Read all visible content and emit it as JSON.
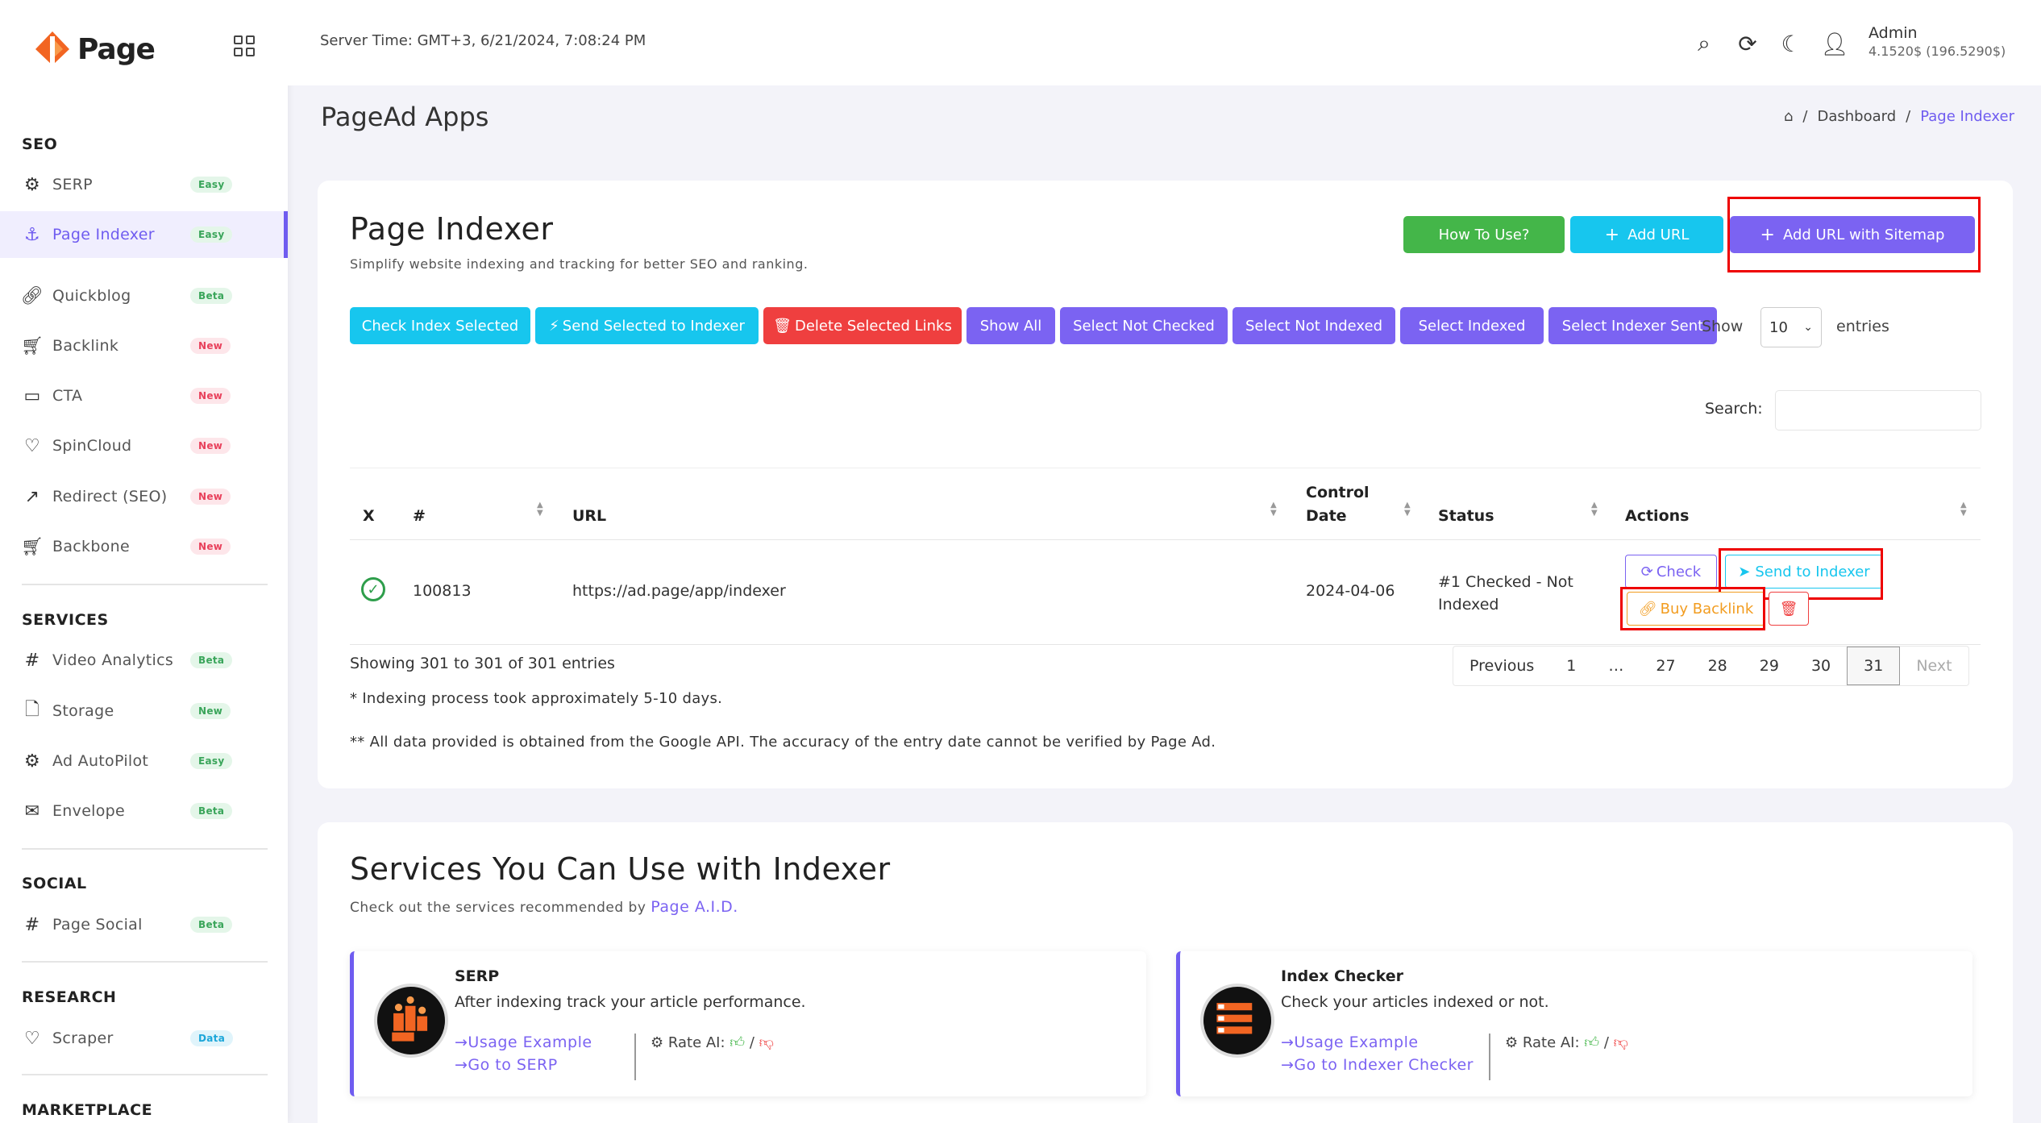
{
  "app": {
    "logo_text": "Page"
  },
  "sidebar": {
    "sections": [
      {
        "title": "SEO"
      },
      {
        "title": "SERVICES"
      },
      {
        "title": "SOCIAL"
      },
      {
        "title": "RESEARCH"
      },
      {
        "title": "MARKETPLACE"
      }
    ],
    "items": [
      {
        "label": "SERP",
        "badge": "Easy"
      },
      {
        "label": "Page Indexer",
        "badge": "Easy"
      },
      {
        "label": "Quickblog",
        "badge": "Beta"
      },
      {
        "label": "Backlink",
        "badge": "New"
      },
      {
        "label": "CTA",
        "badge": "New"
      },
      {
        "label": "SpinCloud",
        "badge": "New"
      },
      {
        "label": "Redirect (SEO)",
        "badge": "New"
      },
      {
        "label": "Backbone",
        "badge": "New"
      },
      {
        "label": "Video Analytics",
        "badge": "Beta"
      },
      {
        "label": "Storage",
        "badge": "New"
      },
      {
        "label": "Ad AutoPilot",
        "badge": "Easy"
      },
      {
        "label": "Envelope",
        "badge": "Beta"
      },
      {
        "label": "Page Social",
        "badge": "Beta"
      },
      {
        "label": "Scraper",
        "badge": "Data"
      }
    ]
  },
  "topbar": {
    "server_time": "Server Time: GMT+3, 6/21/2024, 7:08:24 PM",
    "admin_name": "Admin",
    "admin_balance": "4.1520$ (196.5290$)"
  },
  "header": {
    "page_title": "PageAd Apps",
    "breadcrumb": [
      "Dashboard",
      "/",
      "Page Indexer"
    ]
  },
  "indexer": {
    "title": "Page Indexer",
    "subtitle": "Simplify website indexing and tracking for better SEO and ranking.",
    "top_buttons": {
      "how_to": "How To Use?",
      "add_url": "Add URL",
      "add_sitemap": "Add URL with Sitemap"
    },
    "bulk_buttons": {
      "check_index": "Check Index Selected",
      "send_selected": "Send Selected to Indexer",
      "delete_selected": "Delete Selected Links",
      "show_all": "Show All",
      "not_checked": "Select Not Checked",
      "not_indexed": "Select Not Indexed",
      "indexed": "Select Indexed",
      "indexer_sent": "Select Indexer Sent"
    },
    "show_label": "Show",
    "entries_value": "10",
    "entries_label": "entries",
    "search_label": "Search:",
    "columns": {
      "x": "X",
      "num": "#",
      "url": "URL",
      "control_date_1": "Control",
      "control_date_2": "Date",
      "status": "Status",
      "actions": "Actions"
    },
    "rows": [
      {
        "num": "100813",
        "url": "https://ad.page/app/indexer",
        "date": "2024-04-06",
        "status_1": "#1 Checked - Not",
        "status_2": "Indexed"
      }
    ],
    "actions": {
      "check": "Check",
      "send": "Send to Indexer",
      "buy": "Buy Backlink"
    },
    "showing": "Showing 301 to 301 of 301 entries",
    "pagination": [
      "Previous",
      "1",
      "…",
      "27",
      "28",
      "29",
      "30",
      "31",
      "Next"
    ],
    "note1": "* Indexing process took approximately 5-10 days.",
    "note2": "** All data provided is obtained from the Google API. The accuracy of the entry date cannot be verified by Page Ad."
  },
  "services": {
    "title": "Services You Can Use with Indexer",
    "subtitle_prefix": "Check out the services recommended by",
    "subtitle_link": "Page A.I.D.",
    "cards": [
      {
        "title": "SERP",
        "desc": "After indexing track your article performance.",
        "link1": "Usage Example",
        "link2": "Go to SERP",
        "rate": "Rate AI:",
        "sep": "/"
      },
      {
        "title": "Index Checker",
        "desc": "Check your articles indexed or not.",
        "link1": "Usage Example",
        "link2": "Go to Indexer Checker",
        "rate": "Rate AI:",
        "sep": "/"
      }
    ]
  },
  "colors": {
    "accent": "#7b63f2",
    "green": "#44b649",
    "cyan": "#17c6ee",
    "red": "#ef3f3f",
    "orange": "#f29c1f"
  }
}
